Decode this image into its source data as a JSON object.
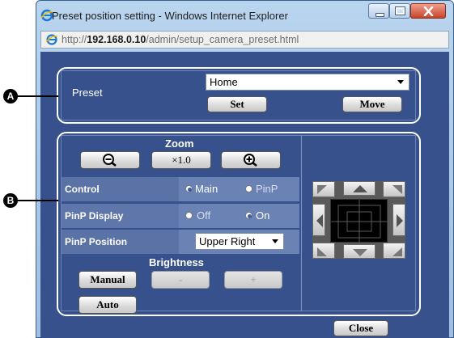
{
  "window": {
    "title": "Preset position setting - Windows Internet Explorer",
    "address_prefix": "http://",
    "address_host": "192.168.0.10",
    "address_path": "/admin/setup_camera_preset.html"
  },
  "callouts": {
    "a": "A",
    "b": "B"
  },
  "preset": {
    "label": "Preset",
    "selected": "Home",
    "set_label": "Set",
    "move_label": "Move"
  },
  "zoom": {
    "label": "Zoom",
    "reset_label": "×1.0"
  },
  "control": {
    "label": "Control",
    "options": [
      "Main",
      "PinP"
    ],
    "selected": "Main"
  },
  "pinp_display": {
    "label": "PinP Display",
    "options": [
      "Off",
      "On"
    ],
    "selected": "On"
  },
  "pinp_position": {
    "label": "PinP Position",
    "selected": "Upper Right"
  },
  "brightness": {
    "label": "Brightness",
    "manual_label": "Manual",
    "minus_label": "-",
    "plus_label": "+",
    "auto_label": "Auto"
  },
  "footer": {
    "close_label": "Close"
  },
  "colors": {
    "panel": "#36518b",
    "row": "#5b72a6",
    "outline": "#ffffff"
  }
}
